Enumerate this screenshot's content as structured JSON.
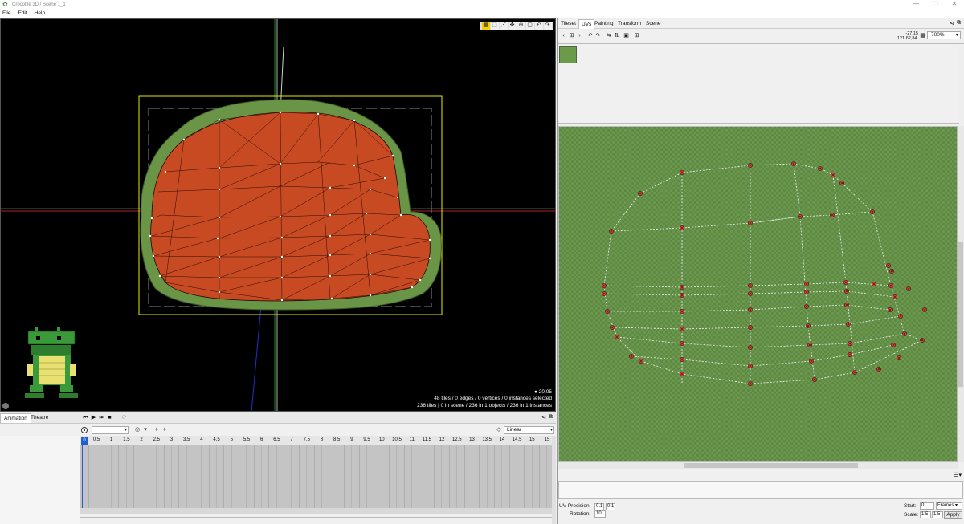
{
  "window": {
    "title": "Crocotile 3D / Scene 1_1",
    "minimize": "—",
    "maximize": "▢",
    "close": "✕"
  },
  "menu": [
    "File",
    "Edit",
    "Help"
  ],
  "viewport": {
    "time": "20:05",
    "selection": "48 tiles / 0 edges / 0 vertices / 0 instances selected",
    "scene": "236 tiles | 0 in scene / 236 in 1 objects / 236 in 1 instances"
  },
  "animation": {
    "tabs": [
      "Animation",
      "Theatre"
    ],
    "interpolation": "Linear",
    "clip": "",
    "cursor_frame": "0",
    "ruler": [
      "0.5",
      "1",
      "1.5",
      "2",
      "2.5",
      "3",
      "3.5",
      "4",
      "4.5",
      "5",
      "5.5",
      "6",
      "6.5",
      "7",
      "7.5",
      "8",
      "8.5",
      "9",
      "9.5",
      "10",
      "10.5",
      "11",
      "11.5",
      "12",
      "12.5",
      "13",
      "13.5",
      "14",
      "14.5",
      "15",
      "15"
    ]
  },
  "right_panel": {
    "tabs": [
      "Tileset",
      "UVs",
      "Painting",
      "Transform",
      "Scene"
    ],
    "active_tab": "UVs",
    "coord_x": "-27.15",
    "coord_y": "121.62,84.",
    "zoom": "700%",
    "uv_precision_label": "UV Precision:",
    "uv_precision_x": "0.1",
    "uv_precision_y": "0.1",
    "rotation_label": "Rotation:",
    "rotation_value": "10",
    "start_label": "Start:",
    "start_value": "0",
    "unit": "Frames",
    "scale_label": "Scale:",
    "scale_x": "1.5",
    "scale_y": "1.5",
    "apply_label": "Apply"
  },
  "colors": {
    "mesh_fill": "#c84a22",
    "rim": "#5e8a3c",
    "uv_bg": "#5e8a42",
    "selection": "#e8e800",
    "accent": "#1f5fd1"
  }
}
